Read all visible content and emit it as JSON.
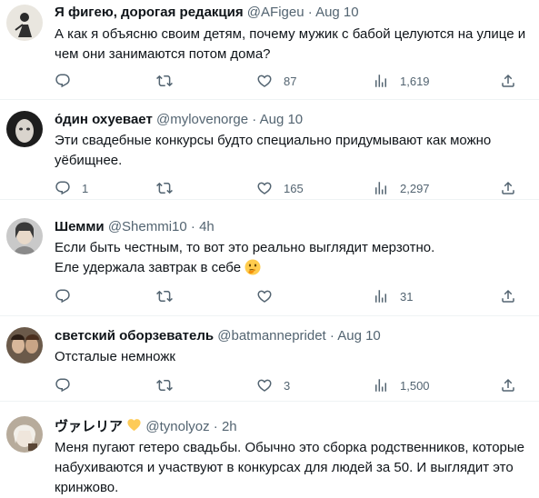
{
  "tweets": [
    {
      "name": "Я фигею, дорогая редакция",
      "handle": "@AFigeu",
      "dot": "·",
      "time": "Aug 10",
      "text_lines": [
        "А как я объясню своим детям, почему мужик с бабой целуются на улице и",
        "чем они занимаются потом дома?"
      ],
      "replies": "",
      "retweets": "",
      "likes": "87",
      "views": "1,619"
    },
    {
      "name": "о́дин охуевает",
      "handle": "@mylovenorge",
      "dot": "·",
      "time": "Aug 10",
      "text_lines": [
        "Эти свадебные конкурсы будто специально придумывают как можно",
        "уёбищнее."
      ],
      "replies": "1",
      "retweets": "",
      "likes": "165",
      "views": "2,297"
    },
    {
      "name": "Шемми",
      "handle": "@Shemmi10",
      "dot": "·",
      "time": "4h",
      "text_lines": [
        "Если быть честным, то вот это реально выглядит мерзотно.",
        "Еле удержала завтрак в себе"
      ],
      "replies": "",
      "retweets": "",
      "likes": "",
      "views": "31"
    },
    {
      "name": "светский оборзеватель",
      "handle": "@batmannepridet",
      "dot": "·",
      "time": "Aug 10",
      "text_lines": [
        "Отсталые немножк"
      ],
      "replies": "",
      "retweets": "",
      "likes": "3",
      "views": "1,500"
    },
    {
      "name": "ヴァレリア",
      "handle": "@tynolyoz",
      "dot": "·",
      "time": "2h",
      "text_lines": [
        "Меня пугают гетеро свадьбы. Обычно это сборка родственников, которые",
        "набухиваются и участвуют в конкурсах для людей за 50. И выглядит это",
        "кринжово."
      ]
    }
  ],
  "icons": {
    "reply": "reply-icon",
    "retweet": "retweet-icon",
    "like": "heart-icon",
    "views": "views-icon",
    "share": "share-icon",
    "emoji": "thinking-face-emoji",
    "badge": "yellow-heart-icon"
  },
  "colors": {
    "text": "#0f1419",
    "secondary": "#536471",
    "divider": "#eff3f4"
  }
}
